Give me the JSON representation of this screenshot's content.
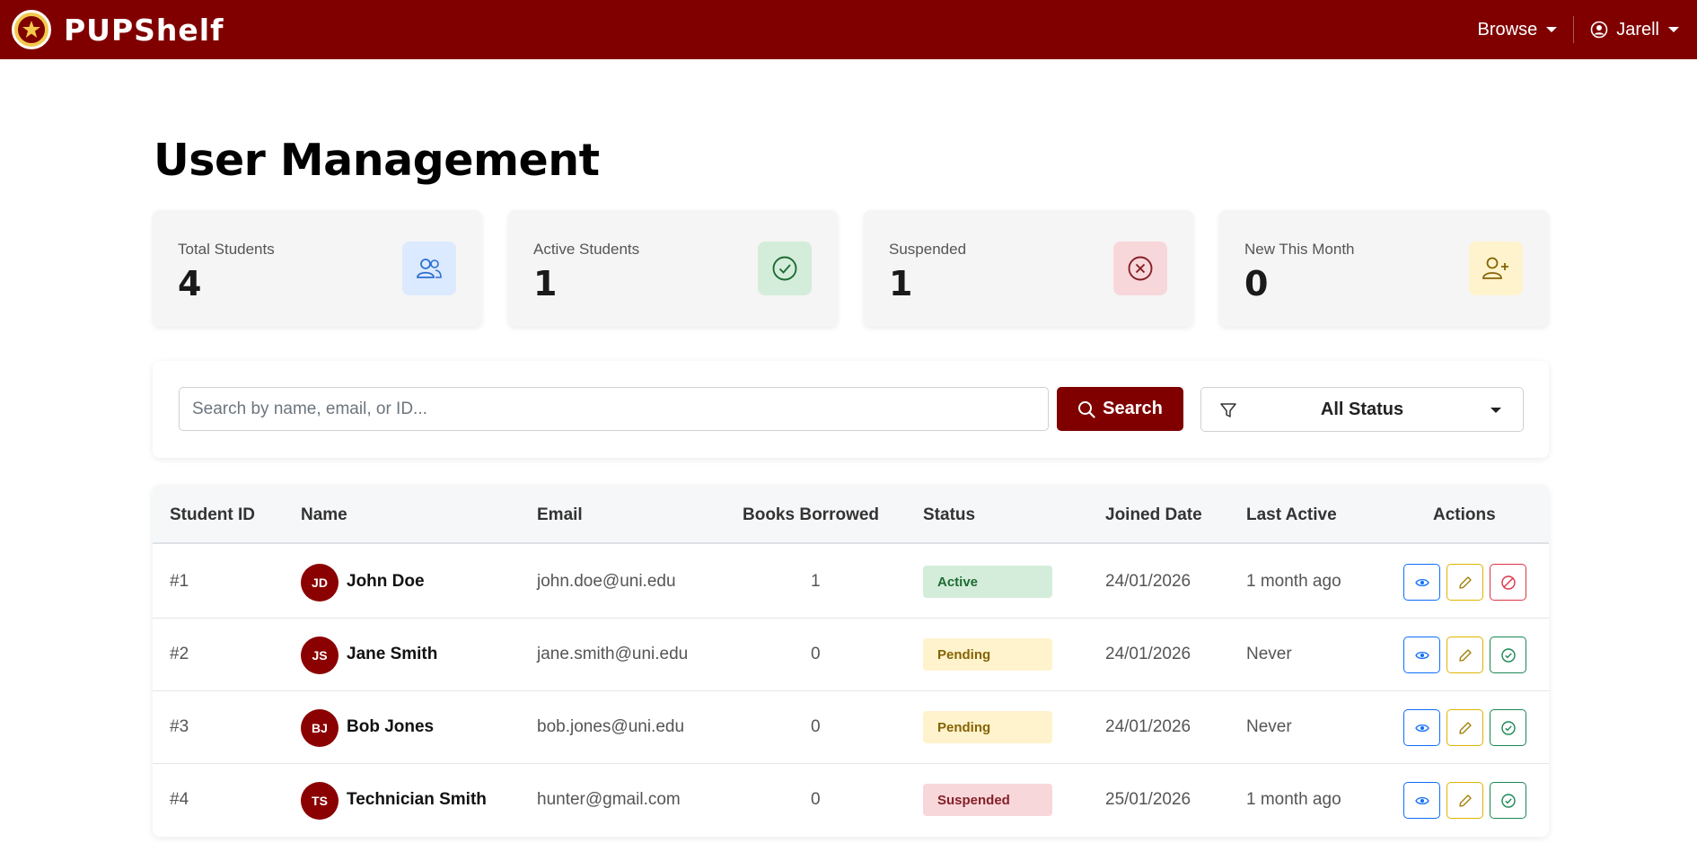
{
  "app": {
    "brand": "PUPShelf"
  },
  "nav": {
    "browse": "Browse",
    "user": "Jarell"
  },
  "page": {
    "title": "User Management"
  },
  "stats": [
    {
      "label": "Total Students",
      "value": "4",
      "icon": "users-icon",
      "color": "#dbeafe"
    },
    {
      "label": "Active Students",
      "value": "1",
      "icon": "check-circle-icon",
      "color": "#d4edda"
    },
    {
      "label": "Suspended",
      "value": "1",
      "icon": "x-circle-icon",
      "color": "#f8d7da"
    },
    {
      "label": "New This Month",
      "value": "0",
      "icon": "user-plus-icon",
      "color": "#fff3cd"
    }
  ],
  "search": {
    "placeholder": "Search by name, email, or ID...",
    "button": "Search",
    "status_filter": "All Status"
  },
  "table": {
    "headers": [
      "Student ID",
      "Name",
      "Email",
      "Books Borrowed",
      "Status",
      "Joined Date",
      "Last Active",
      "Actions"
    ],
    "rows": [
      {
        "id": "#1",
        "initials": "JD",
        "name": "John Doe",
        "email": "john.doe@uni.edu",
        "books": "1",
        "status": "Active",
        "joined": "24/01/2026",
        "last_active": "1 month ago"
      },
      {
        "id": "#2",
        "initials": "JS",
        "name": "Jane Smith",
        "email": "jane.smith@uni.edu",
        "books": "0",
        "status": "Pending",
        "joined": "24/01/2026",
        "last_active": "Never"
      },
      {
        "id": "#3",
        "initials": "BJ",
        "name": "Bob Jones",
        "email": "bob.jones@uni.edu",
        "books": "0",
        "status": "Pending",
        "joined": "24/01/2026",
        "last_active": "Never"
      },
      {
        "id": "#4",
        "initials": "TS",
        "name": "Technician Smith",
        "email": "hunter@gmail.com",
        "books": "0",
        "status": "Suspended",
        "joined": "25/01/2026",
        "last_active": "1 month ago"
      }
    ]
  },
  "colors": {
    "brand": "#800000",
    "active": "#198754",
    "pending": "#856404",
    "suspended": "#dc3545",
    "view": "#0d6efd",
    "edit": "#e0b400"
  }
}
